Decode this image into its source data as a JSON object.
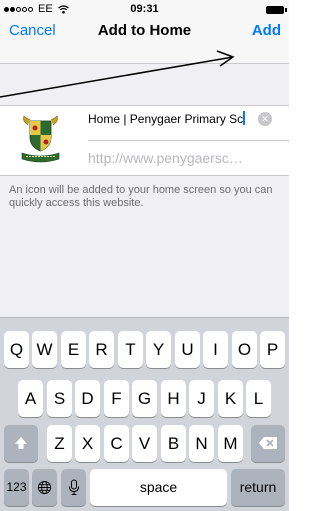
{
  "status_bar": {
    "carrier": "EE",
    "time": "09:31"
  },
  "nav": {
    "cancel_label": "Cancel",
    "title": "Add to Home",
    "add_label": "Add"
  },
  "form": {
    "title_value": "Home | Penygaer Primary Sc",
    "url": "http://www.penygaersc…",
    "icon_name": "penygaer-school-crest-icon"
  },
  "info": {
    "text": "An icon will be added to your home screen so you can quickly access this website."
  },
  "keyboard": {
    "row1": [
      "Q",
      "W",
      "E",
      "R",
      "T",
      "Y",
      "U",
      "I",
      "O",
      "P"
    ],
    "row2": [
      "A",
      "S",
      "D",
      "F",
      "G",
      "H",
      "J",
      "K",
      "L"
    ],
    "row3": [
      "Z",
      "X",
      "C",
      "V",
      "B",
      "N",
      "M"
    ],
    "numbers_label": "123",
    "space_label": "space",
    "return_label": "return"
  },
  "colors": {
    "accent": "#007aff",
    "keyboard_bg": "#d1d5db",
    "group_bg": "#efeff4"
  }
}
